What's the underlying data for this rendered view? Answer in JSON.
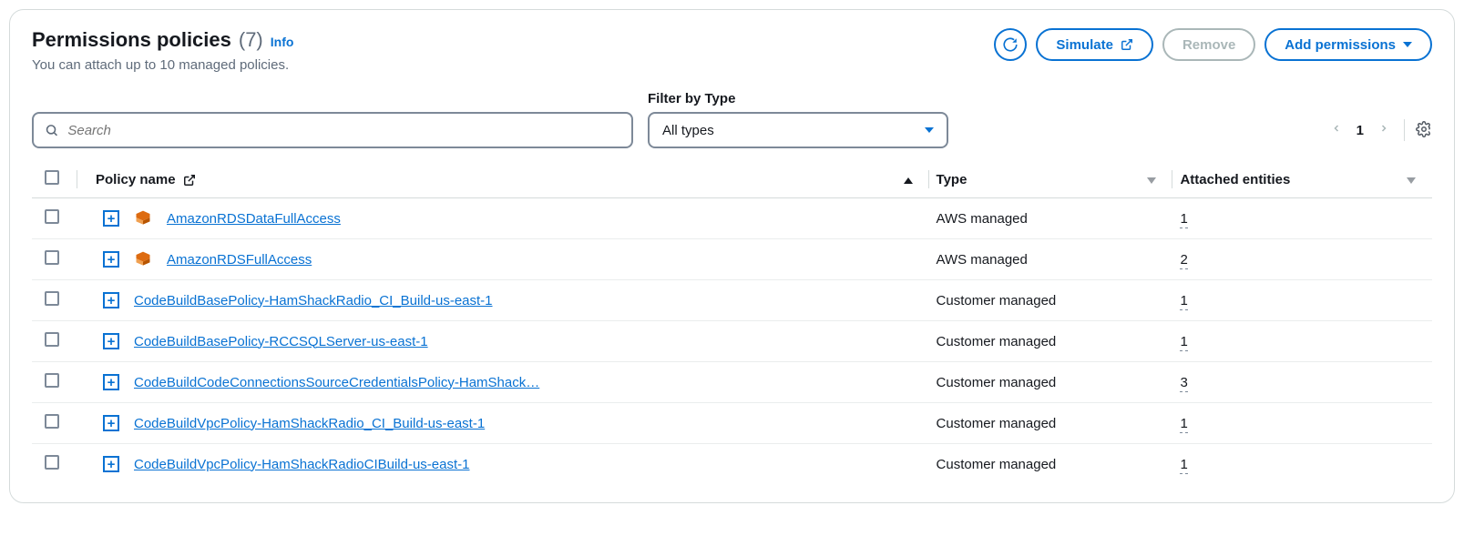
{
  "header": {
    "title": "Permissions policies",
    "count": "(7)",
    "info": "Info",
    "subtitle": "You can attach up to 10 managed policies."
  },
  "actions": {
    "simulate": "Simulate",
    "remove": "Remove",
    "add": "Add permissions"
  },
  "search": {
    "placeholder": "Search"
  },
  "filter": {
    "label": "Filter by Type",
    "selected": "All types"
  },
  "pagination": {
    "current": "1"
  },
  "columns": {
    "name": "Policy name",
    "type": "Type",
    "entities": "Attached entities"
  },
  "rows": [
    {
      "name": "AmazonRDSDataFullAccess",
      "type": "AWS managed",
      "entities": "1",
      "aws": true
    },
    {
      "name": "AmazonRDSFullAccess",
      "type": "AWS managed",
      "entities": "2",
      "aws": true
    },
    {
      "name": "CodeBuildBasePolicy-HamShackRadio_CI_Build-us-east-1",
      "type": "Customer managed",
      "entities": "1",
      "aws": false
    },
    {
      "name": "CodeBuildBasePolicy-RCCSQLServer-us-east-1",
      "type": "Customer managed",
      "entities": "1",
      "aws": false
    },
    {
      "name": "CodeBuildCodeConnectionsSourceCredentialsPolicy-HamShack…",
      "type": "Customer managed",
      "entities": "3",
      "aws": false
    },
    {
      "name": "CodeBuildVpcPolicy-HamShackRadio_CI_Build-us-east-1",
      "type": "Customer managed",
      "entities": "1",
      "aws": false
    },
    {
      "name": "CodeBuildVpcPolicy-HamShackRadioCIBuild-us-east-1",
      "type": "Customer managed",
      "entities": "1",
      "aws": false
    }
  ]
}
